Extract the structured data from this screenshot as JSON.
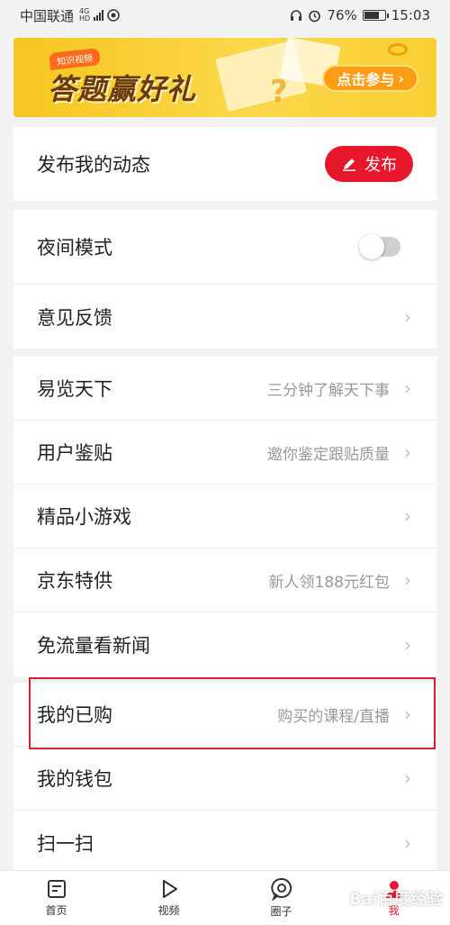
{
  "status_bar": {
    "carrier": "中国联通",
    "net_top": "4G",
    "net_bottom": "HD",
    "battery": "76%",
    "time": "15:03"
  },
  "banner": {
    "tag": "知识视频",
    "title": "答题赢好礼",
    "button": "点击参与"
  },
  "publish": {
    "label": "发布我的动态",
    "button": "发布"
  },
  "settings": [
    {
      "label": "夜间模式"
    },
    {
      "label": "意见反馈"
    }
  ],
  "menu": [
    {
      "label": "易览天下",
      "sub": "三分钟了解天下事"
    },
    {
      "label": "用户鉴贴",
      "sub": "邀你鉴定跟贴质量"
    },
    {
      "label": "精品小游戏",
      "sub": ""
    },
    {
      "label": "京东特供",
      "sub": "新人领188元红包"
    },
    {
      "label": "免流量看新闻",
      "sub": ""
    },
    {
      "label": "我的已购",
      "sub": "购买的课程/直播"
    },
    {
      "label": "我的钱包",
      "sub": ""
    },
    {
      "label": "扫一扫",
      "sub": ""
    }
  ],
  "tabs": [
    {
      "label": "首页"
    },
    {
      "label": "视频"
    },
    {
      "label": "圈子"
    },
    {
      "label": "我"
    }
  ],
  "watermark": "Bai百度经验",
  "colors": {
    "accent": "#e8162b",
    "highlight": "#d0203a",
    "banner": "#f9cf34"
  }
}
